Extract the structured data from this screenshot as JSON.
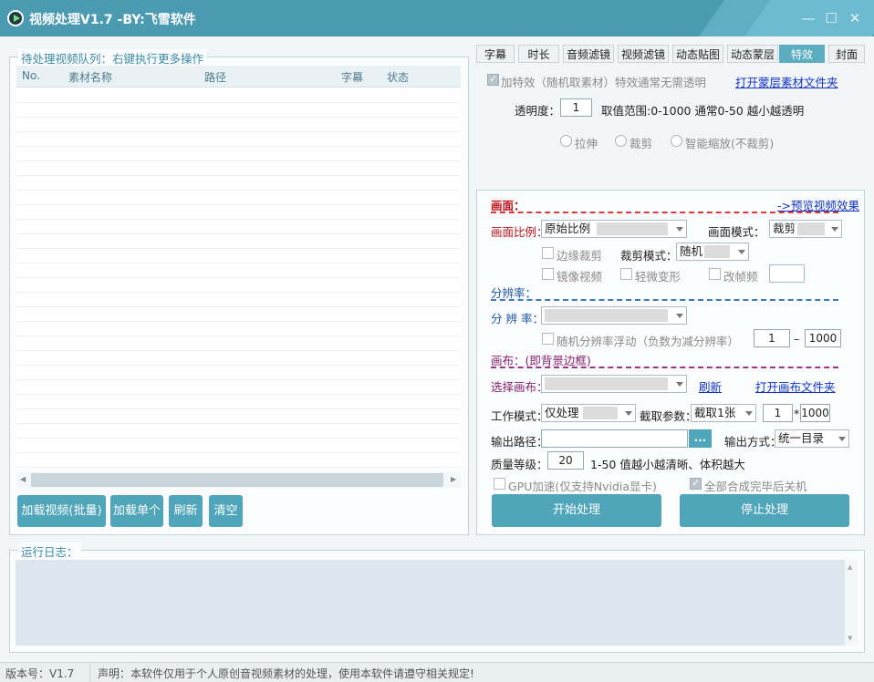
{
  "window": {
    "title": "视频处理V1.7 -BY:飞雪软件",
    "minimize": "—",
    "maximize": "☐",
    "close": "✕"
  },
  "queue": {
    "group_label": "待处理视频队列：右键执行更多操作",
    "columns": [
      "No.",
      "素材名称",
      "路径",
      "字幕",
      "状态"
    ],
    "buttons": {
      "load_batch": "加载视频(批量)",
      "load_single": "加载单个",
      "refresh": "刷新",
      "clear": "清空"
    }
  },
  "tabs": [
    "字幕",
    "时长",
    "音频滤镜",
    "视频滤镜",
    "动态贴图",
    "动态蒙层",
    "特效",
    "封面"
  ],
  "active_tab": "特效",
  "effects": {
    "add_effect_label": "加特效（随机取素材）特效通常无需透明",
    "add_effect_checked": true,
    "open_mask_folder": "打开蒙层素材文件夹",
    "opacity_label": "透明度：",
    "opacity_value": "1",
    "opacity_hint": "取值范围:0-1000 通常0-50 越小越透明",
    "modes": [
      "拉伸",
      "裁剪",
      "智能缩放(不裁剪)"
    ]
  },
  "frame": {
    "section_title": "画面：",
    "preview_link": "->预览视频效果",
    "ratio_label": "画面比例：",
    "ratio_value": "原始比例",
    "mode_label": "画面模式：",
    "mode_value": "裁剪",
    "edge_crop": "边缘裁剪",
    "crop_mode_label": "裁剪模式：",
    "crop_mode_value": "随机",
    "mirror": "镜像视频",
    "deform": "轻微变形",
    "fps": "改帧频"
  },
  "resolution": {
    "section_title": "分辨率：",
    "label": "分 辨 率：",
    "value": "",
    "random_float": "随机分辨率浮动（负数为减分辨率）",
    "min": "1",
    "dash": "–",
    "max": "1000"
  },
  "canvas": {
    "section_title": "画布：(即背景边框)",
    "select_label": "选择画布：",
    "value": "",
    "refresh": "刷新",
    "open_folder": "打开画布文件夹"
  },
  "work": {
    "mode_label": "工作模式：",
    "mode_value": "仅处理",
    "param_label": "截取参数：",
    "param_value": "截取1张",
    "count": "1",
    "times": "*",
    "count2": "1000",
    "output_path_label": "输出路径：",
    "output_path_value": "",
    "browse": "...",
    "output_mode_label": "输出方式：",
    "output_mode_value": "统一目录",
    "quality_label": "质量等级：",
    "quality_value": "20",
    "quality_hint": "1-50 值越小越清晰、体积越大",
    "gpu": "GPU加速(仅支持Nvidia显卡)",
    "gpu_checked": false,
    "shutdown": "全部合成完毕后关机",
    "shutdown_checked": true,
    "start": "开始处理",
    "stop": "停止处理"
  },
  "log": {
    "group_label": "运行日志："
  },
  "status": {
    "version": "版本号：V1.7",
    "statement": "声明：本软件仅用于个人原创音视频素材的处理，使用本软件请遵守相关规定!"
  },
  "colors": {
    "titlebar": "#4a9ab2",
    "button": "#4fa5ba",
    "active_tab": "#5cadc1",
    "link": "#1133cc",
    "red_section": "#c0141b",
    "blue_section": "#1e57a6",
    "purple_section": "#862070"
  }
}
